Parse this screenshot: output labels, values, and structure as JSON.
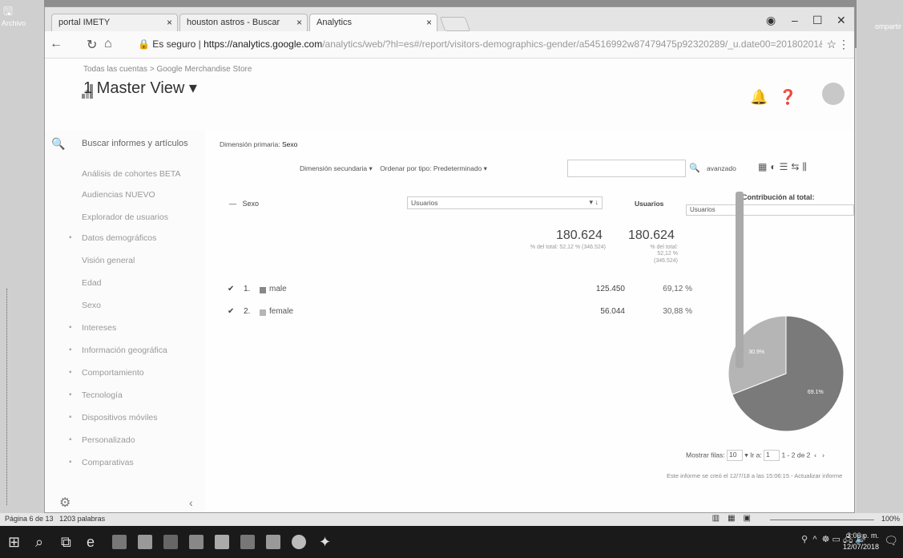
{
  "word": {
    "archivo": "Archivo",
    "compartir": "ompartir",
    "status_page": "Página 6 de 13",
    "status_words": "1203 palabras",
    "zoom": "100%"
  },
  "browser": {
    "tabs": [
      {
        "label": "portal IMETY"
      },
      {
        "label": "houston astros - Buscar"
      },
      {
        "label": "Analytics"
      }
    ],
    "secure_label": "Es seguro",
    "url_host": "https://analytics.google.com",
    "url_path": "/analytics/web/?hl=es#/report/visitors-demographics-gender/a54516992w87479475p92320289/_u.date00=20180201&_u..."
  },
  "ga": {
    "breadcrumb": "Todas las cuentas > Google Merchandise Store",
    "view_title": "1 Master View ▾"
  },
  "sidebar": {
    "search_placeholder": "Buscar informes y artículos",
    "items": [
      {
        "label": "Análisis de cohortes BETA"
      },
      {
        "label": "Audiencias NUEVO"
      },
      {
        "label": "Explorador de usuarios"
      },
      {
        "label": "Datos demográficos"
      },
      {
        "label": "Visión general"
      },
      {
        "label": "Edad"
      },
      {
        "label": "Sexo"
      },
      {
        "label": "Intereses"
      },
      {
        "label": "Información geográfica"
      },
      {
        "label": "Comportamiento"
      },
      {
        "label": "Tecnología"
      },
      {
        "label": "Dispositivos móviles"
      },
      {
        "label": "Personalizado"
      },
      {
        "label": "Comparativas"
      }
    ]
  },
  "report": {
    "primary_dimension_label": "Dimensión primaria:",
    "primary_dimension_value": "Sexo",
    "secondary_dimension": "Dimensión secundaria ▾",
    "sort_label": "Ordenar por tipo:",
    "sort_value": "Predeterminado ▾",
    "advanced": "avanzado",
    "col_dimension": "Sexo",
    "metric_select": "Usuarios",
    "col_metric": "Usuarios",
    "contribution_label": "Contribución al total:",
    "contribution_select": "Usuarios",
    "total_value": "180.624",
    "total_note": "% del total: 52,12 % (346.524)",
    "total_value2": "180.624",
    "total_note2_a": "% del total:",
    "total_note2_b": "52,12 %",
    "total_note2_c": "(346.524)",
    "rows": [
      {
        "idx": "1.",
        "dim": "male",
        "value": "125.450",
        "pct": "69,12 %"
      },
      {
        "idx": "2.",
        "dim": "female",
        "value": "56.044",
        "pct": "30,88 %"
      }
    ],
    "pager_rows_label": "Mostrar filas:",
    "pager_rows_value": "10",
    "pager_goto_label": "Ir a:",
    "pager_goto_value": "1",
    "pager_range": "1 - 2 de 2",
    "report_note": "Este informe se creó el 12/7/18 a las 15:06:15 - Actualizar informe"
  },
  "chart_data": {
    "type": "pie",
    "categories": [
      "male",
      "female"
    ],
    "values": [
      69.1,
      30.9
    ],
    "labels": [
      "69.1%",
      "30.9%"
    ],
    "colors": [
      "#7a7a7a",
      "#b5b5b5"
    ]
  },
  "taskbar": {
    "time": "3:06 p. m.",
    "date": "12/07/2018"
  }
}
